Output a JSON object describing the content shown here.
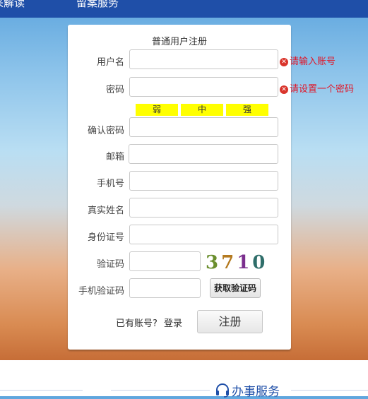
{
  "header": {
    "nav_left": "采解读",
    "nav_right": "留案服务"
  },
  "form": {
    "title": "普通用户注册",
    "fields": [
      {
        "label": "用户名",
        "value": ""
      },
      {
        "label": "密码",
        "value": ""
      },
      {
        "label": "确认密码",
        "value": ""
      },
      {
        "label": "邮箱",
        "value": ""
      },
      {
        "label": "手机号",
        "value": ""
      },
      {
        "label": "真实姓名",
        "value": ""
      },
      {
        "label": "身份证号",
        "value": ""
      },
      {
        "label": "验证码",
        "value": ""
      },
      {
        "label": "手机验证码",
        "value": ""
      }
    ],
    "errors": {
      "username": "请输入账号",
      "password": "请设置一个密码"
    },
    "strength": {
      "weak": "弱",
      "medium": "中",
      "strong": "强"
    },
    "captcha": [
      "3",
      "7",
      "1",
      "0"
    ],
    "sms_button": "获取验证码",
    "login_hint": "已有账号?",
    "login_link": "登录",
    "register_button": "注册"
  },
  "footer": {
    "service_label": "办事服务"
  },
  "colors": {
    "primary": "#1f4fa8",
    "error": "#e0182a",
    "strength_bg": "#ffff00"
  }
}
